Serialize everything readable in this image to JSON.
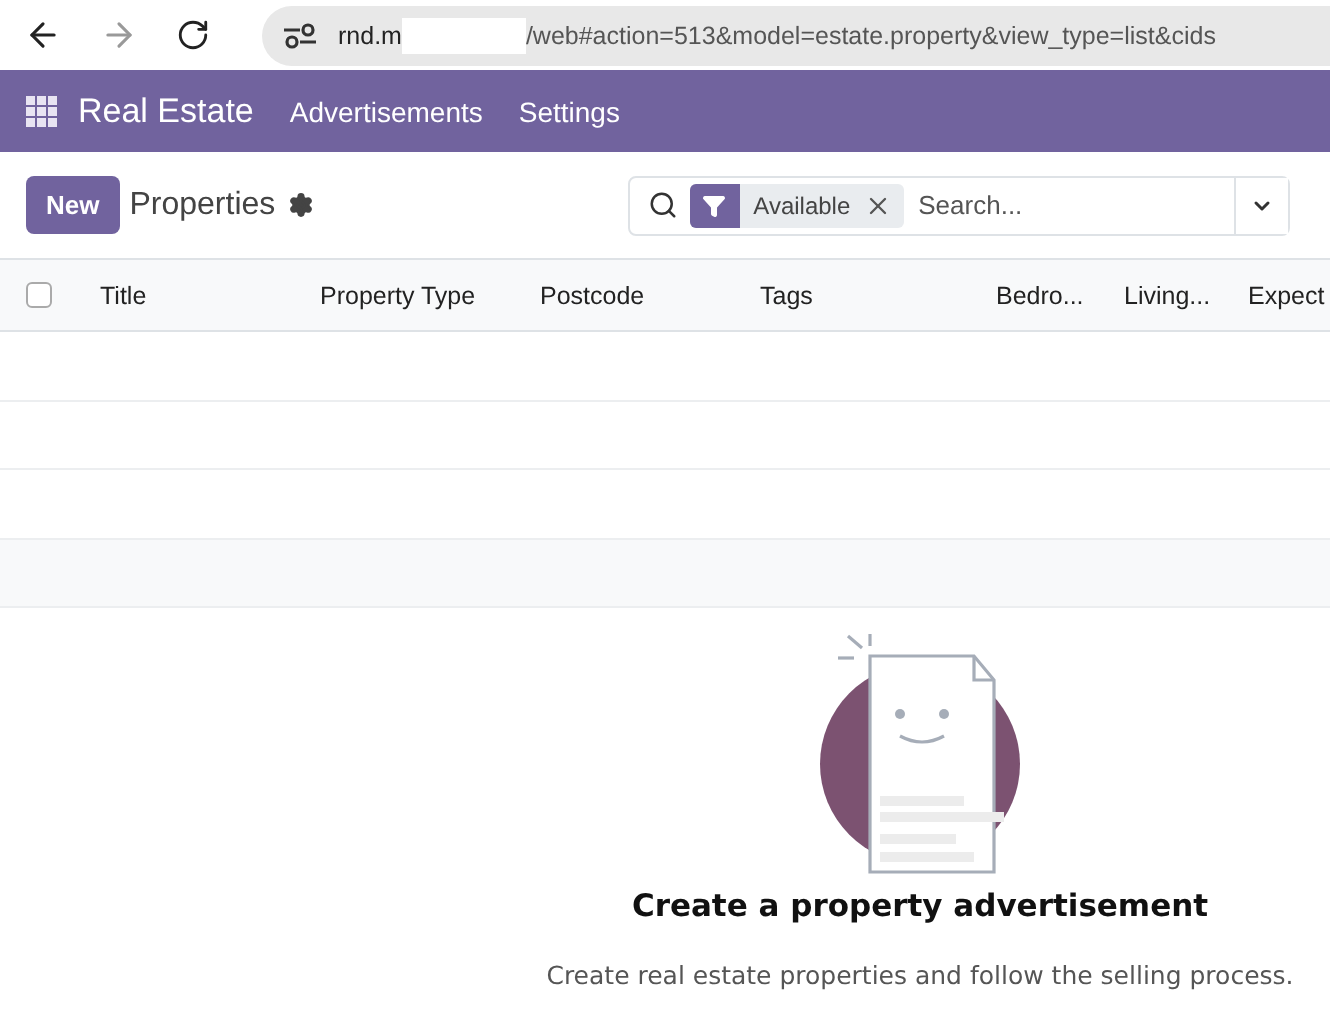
{
  "browser": {
    "url_start": "rnd.m",
    "url_end": "/web#action=513&model=estate.property&view_type=list&cids"
  },
  "navbar": {
    "app_name": "Real Estate",
    "menus": [
      "Advertisements",
      "Settings"
    ]
  },
  "control_panel": {
    "new_button": "New",
    "breadcrumb": "Properties",
    "facets": [
      {
        "label": "Available"
      }
    ],
    "search": {
      "placeholder": "Search..."
    }
  },
  "table": {
    "select_all_checked": false,
    "columns": [
      "Title",
      "Property Type",
      "Postcode",
      "Tags",
      "Bedro...",
      "Living...",
      "Expect"
    ]
  },
  "empty_state": {
    "title": "Create a property advertisement",
    "text": "Create real estate properties and follow the selling process."
  }
}
